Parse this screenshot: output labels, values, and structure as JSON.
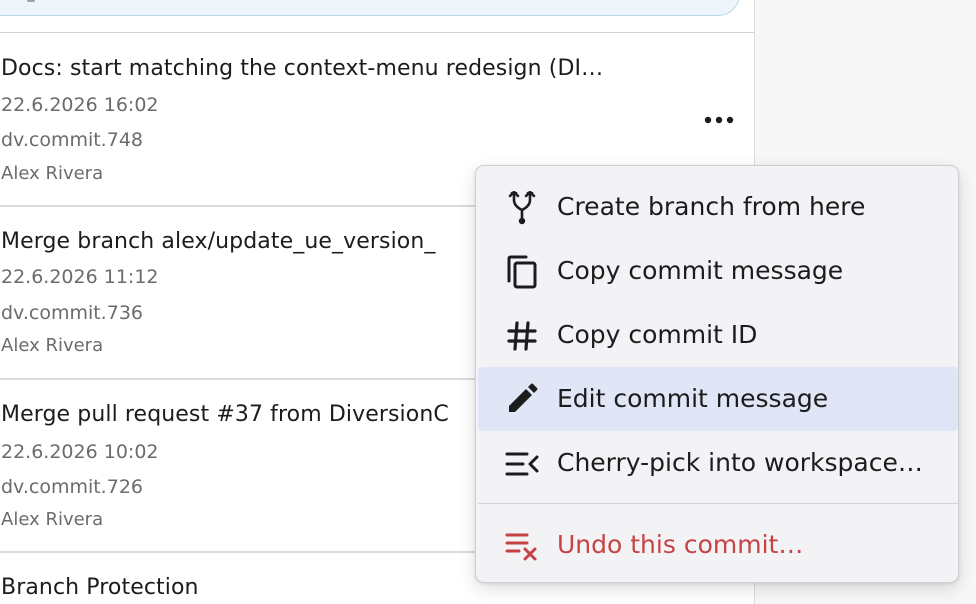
{
  "commits": [
    {
      "title": "Docs: start matching the context-menu redesign (DI…",
      "date": "22.6.2026 16:02",
      "id": "dv.commit.748",
      "author": "Alex Rivera"
    },
    {
      "title": "Merge branch alex/update_ue_version_",
      "date": "22.6.2026 11:12",
      "id": "dv.commit.736",
      "author": "Alex Rivera"
    },
    {
      "title": "Merge pull request #37 from DiversionC",
      "date": "22.6.2026 10:02",
      "id": "dv.commit.726",
      "author": "Alex Rivera"
    },
    {
      "title": "Branch Protection"
    }
  ],
  "context_menu": {
    "items": [
      {
        "label": "Create branch from here",
        "icon": "git-fork-icon"
      },
      {
        "label": "Copy commit message",
        "icon": "copy-icon"
      },
      {
        "label": "Copy commit ID",
        "icon": "hash-icon"
      },
      {
        "label": "Edit commit message",
        "icon": "pencil-icon",
        "highlighted": true
      },
      {
        "label": "Cherry-pick into workspace…",
        "icon": "cherry-pick-icon"
      },
      {
        "label": "Undo this commit…",
        "icon": "undo-commit-icon",
        "danger": true
      }
    ]
  },
  "colors": {
    "danger": "#c64244",
    "highlight": "#e1e6f6",
    "menu_background": "#f3f3f6"
  }
}
